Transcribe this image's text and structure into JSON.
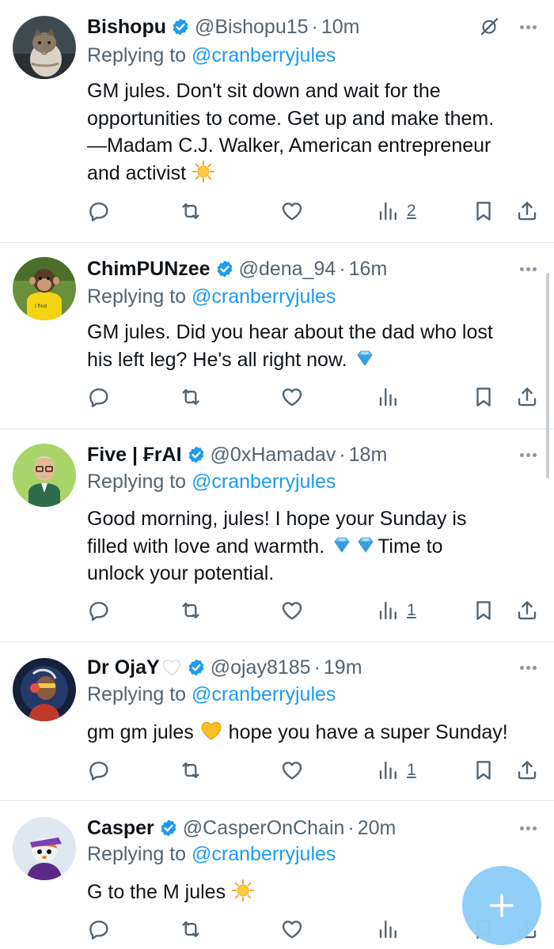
{
  "colors": {
    "accent": "#1d9bf0",
    "secondary_text": "#536471",
    "divider": "#e1e6ea",
    "fab": "#8ecdf8"
  },
  "tweets": [
    {
      "name": "Bishopu",
      "handle": "@Bishopu15",
      "separator": "·",
      "time": "10m",
      "replying_prefix": "Replying to ",
      "replying_to": "@cranberryjules",
      "text_lines": [
        "GM jules. Don't sit down and wait for the",
        "opportunities to come. Get up and make them.",
        "—Madam C.J. Walker, American entrepreneur",
        "and activist"
      ],
      "trailing_emoji": "sun-emoji",
      "views": "2",
      "has_grok_icon": true
    },
    {
      "name": "ChimPUNzee",
      "handle": "@dena_94",
      "separator": "·",
      "time": "16m",
      "replying_prefix": "Replying to ",
      "replying_to": "@cranberryjules",
      "text_lines": [
        "GM jules. Did you hear about the dad who lost",
        "his left leg? He's all right now."
      ],
      "trailing_emoji": "gem-emoji",
      "views": ""
    },
    {
      "name": "Five | ₣rAI",
      "handle": "@0xHamadav",
      "separator": "·",
      "time": "18m",
      "replying_prefix": "Replying to ",
      "replying_to": "@cranberryjules",
      "text_line1": "Good morning, jules! I hope your Sunday is",
      "text_line2_a": "filled with love and warmth. ",
      "text_line2_b": "Time to",
      "text_line3": "unlock your potential.",
      "views": "1"
    },
    {
      "name": "Dr OjaY",
      "handle": "@ojay8185",
      "separator": "·",
      "time": "19m",
      "replying_prefix": "Replying to ",
      "replying_to": "@cranberryjules",
      "text_a": "gm gm jules ",
      "text_b": " hope you have a super Sunday!",
      "views": "1"
    },
    {
      "name": "Casper",
      "handle": "@CasperOnChain",
      "separator": "·",
      "time": "20m",
      "replying_prefix": "Replying to ",
      "replying_to": "@cranberryjules",
      "text": "G to the M jules ",
      "trailing_emoji": "sun-emoji",
      "views": ""
    }
  ],
  "icons": {
    "reply": "reply-icon",
    "retweet": "retweet-icon",
    "like": "heart-icon",
    "views": "views-icon",
    "bookmark": "bookmark-icon",
    "share": "share-icon",
    "more": "more-icon",
    "verified": "verified-badge-icon",
    "compose": "compose-plus-icon"
  }
}
